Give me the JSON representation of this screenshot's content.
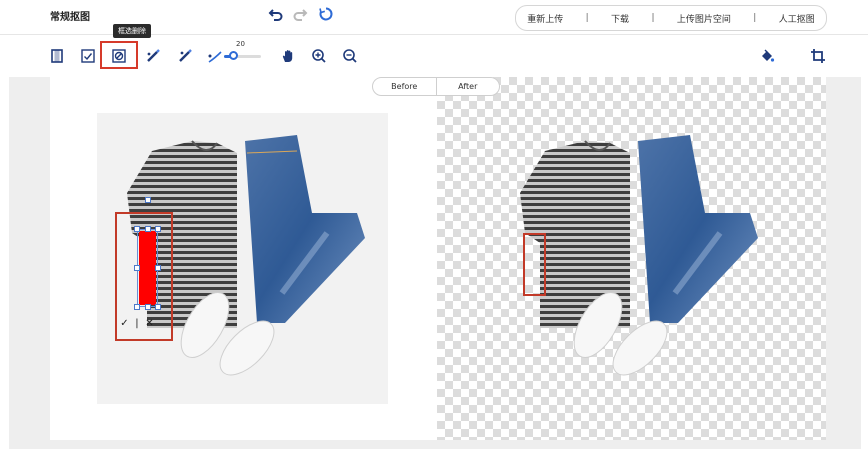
{
  "app": {
    "title": "常规抠图"
  },
  "header": {
    "menu": [
      {
        "label": "重新上传"
      },
      {
        "label": "下载"
      },
      {
        "label": "上传图片空间"
      },
      {
        "label": "人工抠图"
      }
    ],
    "separator": "|"
  },
  "toolbar": {
    "active_tool_tooltip": "框选删除",
    "brush_size": "20",
    "accent_color": "#2e6bd6",
    "highlight_color": "#d63a2a"
  },
  "view_toggle": {
    "before_label": "Before",
    "after_label": "After"
  },
  "selection": {
    "confirm_label": "✓",
    "cancel_label": "✕",
    "divider": "|",
    "fill_color": "#ff0000"
  }
}
